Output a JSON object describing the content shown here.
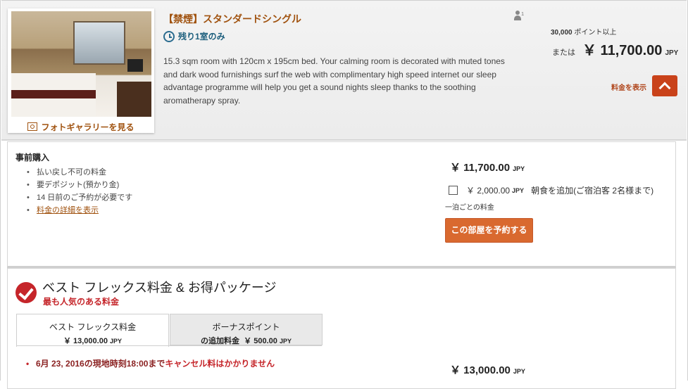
{
  "room": {
    "title": "【禁煙】スタンダードシングル",
    "availability": "残り1室のみ",
    "description": "15.3 sqm room with 120cm x 195cm bed. Your calming room is decorated with muted tones and dark wood furnishings surf the web with complimentary high speed internet our sleep advantage programme will help you get a sound nights sleep thanks to the soothing aromatherapy spray.",
    "photo_gallery_label": "フォトギャラリーを見る",
    "occupancy": "1",
    "points_amount": "30,000",
    "points_suffix": "ポイント以上",
    "or_label": "または",
    "price": "￥ 11,700.00",
    "currency": "JPY",
    "show_rates_label": "料金を表示"
  },
  "prepay": {
    "title": "事前購入",
    "bullets": [
      "払い戻し不可の料金",
      "要デポジット(預かり金)",
      "14 日前のご予約が必要です"
    ],
    "details_link": "料金の詳細を表示",
    "price": "￥ 11,700.00",
    "currency": "JPY",
    "breakfast_price": "￥ 2,000.00",
    "breakfast_currency": "JPY",
    "breakfast_label": "朝食を追加(ご宿泊客 2名様まで)",
    "per_night": "一泊ごとの料金",
    "book_button": "この部屋を予約する"
  },
  "flex": {
    "title": "ベスト フレックス料金 & お得パッケージ",
    "subtitle": "最も人気のある料金",
    "tabs": [
      {
        "label": "ベスト フレックス料金",
        "price": "￥ 13,000.00",
        "currency": "JPY"
      },
      {
        "label": "ボーナスポイント",
        "label2": "の追加料金",
        "price": "￥ 500.00",
        "currency": "JPY"
      }
    ],
    "cancel_date": "6月 23, 2016の現地時刻18:00まで",
    "cancel_text": "キャンセル料はかかりません",
    "price": "￥ 13,000.00",
    "currency": "JPY"
  }
}
